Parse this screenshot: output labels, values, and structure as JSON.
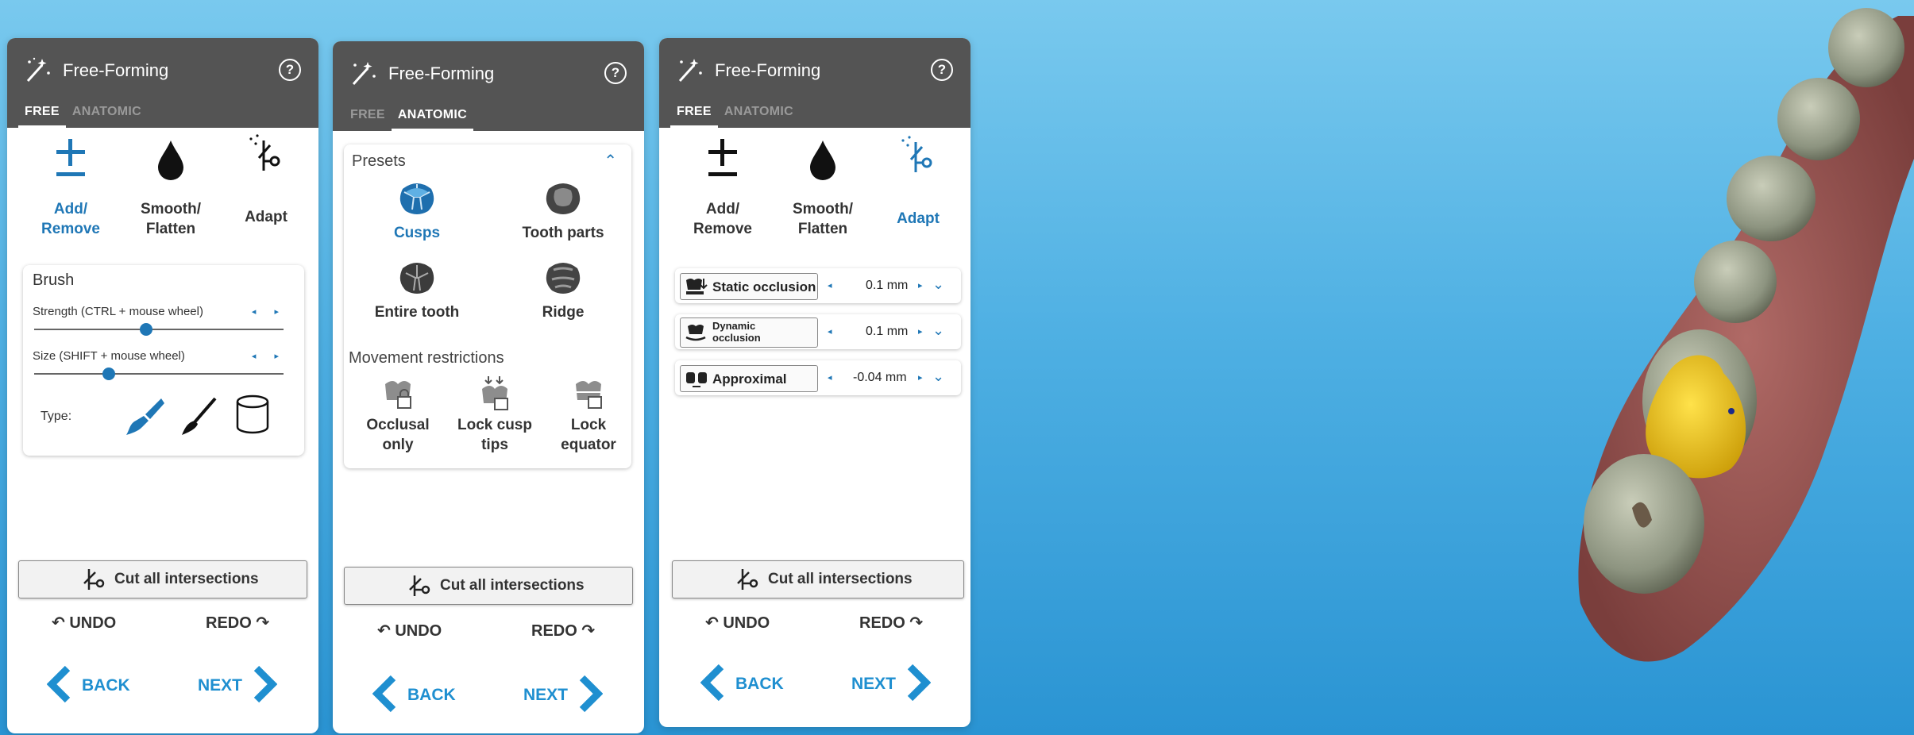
{
  "colors": {
    "accent": "#1f77b6",
    "header": "#545454",
    "background": "#3aa4de",
    "crown": "#e8c41c"
  },
  "panel1": {
    "title": "Free-Forming",
    "help": "?",
    "tabs": [
      {
        "label": "FREE",
        "active": true
      },
      {
        "label": "ANATOMIC",
        "active": false
      }
    ],
    "tools": [
      {
        "label": "Add/\nRemove",
        "selected": true,
        "icon": "plus-minus-icon"
      },
      {
        "label": "Smooth/\nFlatten",
        "selected": false,
        "icon": "drop-icon"
      },
      {
        "label": "Adapt",
        "selected": false,
        "icon": "adapt-scissors-icon"
      }
    ],
    "brush": {
      "title": "Brush",
      "strength_label": "Strength (CTRL + mouse wheel)",
      "strength_value": 0.45,
      "size_label": "Size (SHIFT + mouse wheel)",
      "size_value": 0.3,
      "type_label": "Type:",
      "types": [
        "paint-brush-icon",
        "fine-brush-icon",
        "cylinder-icon"
      ]
    },
    "cut": "Cut all intersections",
    "undo": "UNDO",
    "redo": "REDO",
    "back": "BACK",
    "next": "NEXT"
  },
  "panel2": {
    "title": "Free-Forming",
    "help": "?",
    "tabs": [
      {
        "label": "FREE",
        "active": false
      },
      {
        "label": "ANATOMIC",
        "active": true
      }
    ],
    "presets_title": "Presets",
    "presets": [
      {
        "label": "Cusps",
        "selected": true
      },
      {
        "label": "Tooth parts",
        "selected": false
      },
      {
        "label": "Entire tooth",
        "selected": false
      },
      {
        "label": "Ridge",
        "selected": false
      }
    ],
    "restrictions_title": "Movement restrictions",
    "restrictions": [
      {
        "label": "Occlusal\nonly"
      },
      {
        "label": "Lock cusp\ntips"
      },
      {
        "label": "Lock\nequator"
      }
    ],
    "cut": "Cut all intersections",
    "undo": "UNDO",
    "redo": "REDO",
    "back": "BACK",
    "next": "NEXT"
  },
  "panel3": {
    "title": "Free-Forming",
    "help": "?",
    "tabs": [
      {
        "label": "FREE",
        "active": true
      },
      {
        "label": "ANATOMIC",
        "active": false
      }
    ],
    "tools": [
      {
        "label": "Add/\nRemove",
        "selected": false
      },
      {
        "label": "Smooth/\nFlatten",
        "selected": false
      },
      {
        "label": "Adapt",
        "selected": true
      }
    ],
    "occlusion": [
      {
        "label": "Static occlusion",
        "value": "0.1 mm"
      },
      {
        "label": "Dynamic\nocclusion",
        "value": "0.1 mm"
      },
      {
        "label": "Approximal",
        "value": "-0.04 mm"
      }
    ],
    "cut": "Cut all intersections",
    "undo": "UNDO",
    "redo": "REDO",
    "back": "BACK",
    "next": "NEXT"
  }
}
